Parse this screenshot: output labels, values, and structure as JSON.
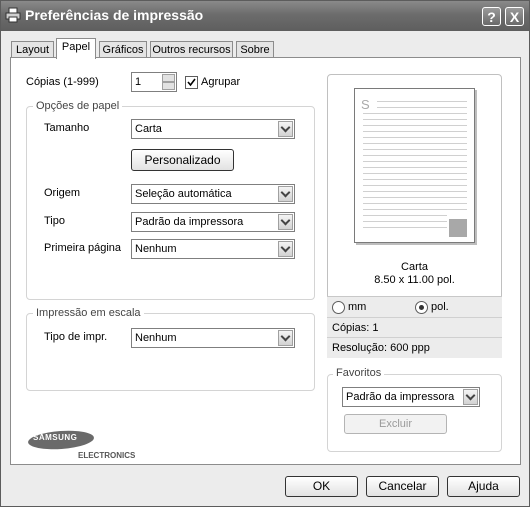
{
  "window": {
    "title": "Preferências de impressão",
    "help_glyph": "?",
    "close_glyph": "X"
  },
  "tabs": [
    {
      "label": "Layout"
    },
    {
      "label": "Papel"
    },
    {
      "label": "Gráficos"
    },
    {
      "label": "Outros recursos"
    },
    {
      "label": "Sobre"
    }
  ],
  "copies": {
    "label": "Cópias (1-999)",
    "value": "1",
    "collate_label": "Agrupar",
    "collate_checked": true
  },
  "paper_options": {
    "title": "Opções de papel",
    "size_label": "Tamanho",
    "size_value": "Carta",
    "custom_button": "Personalizado",
    "source_label": "Origem",
    "source_value": "Seleção automática",
    "type_label": "Tipo",
    "type_value": "Padrão da impressora",
    "first_page_label": "Primeira página",
    "first_page_value": "Nenhum"
  },
  "scaling": {
    "title": "Impressão em escala",
    "type_label": "Tipo de impr.",
    "type_value": "Nenhum"
  },
  "preview": {
    "paper_letter": "S",
    "paper_name": "Carta",
    "paper_dims": "8.50 x 11.00 pol.",
    "unit_mm": "mm",
    "unit_pol": "pol.",
    "selected_unit": "pol.",
    "copies_text": "Cópias: 1",
    "resolution_text": "Resolução: 600 ppp"
  },
  "favorites": {
    "title": "Favoritos",
    "value": "Padrão da impressora",
    "delete_button": "Excluir"
  },
  "logo": {
    "brand": "SAMSUNG",
    "sub": "ELECTRONICS"
  },
  "footer": {
    "ok": "OK",
    "cancel": "Cancelar",
    "help": "Ajuda"
  }
}
